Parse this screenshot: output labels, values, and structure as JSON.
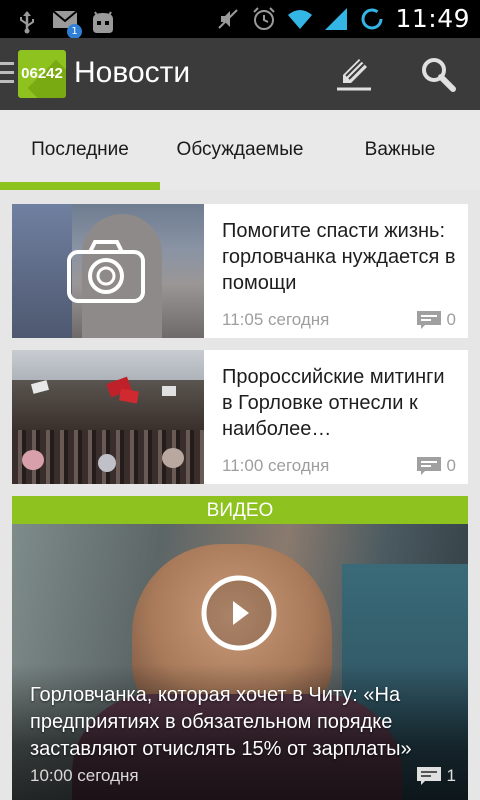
{
  "status_bar": {
    "time": "11:49",
    "left_icons": [
      "usb-icon",
      "mail-icon",
      "cyanogen-icon"
    ],
    "right_icons": [
      "mute-icon",
      "alarm-icon",
      "wifi-icon",
      "signal-icon",
      "battery-icon"
    ],
    "notification_count": "1"
  },
  "app_bar": {
    "logo_text": "06242",
    "title": "Новости",
    "accent_color": "#8dc21f",
    "actions": [
      "pencil-icon",
      "search-icon"
    ]
  },
  "tabs": [
    {
      "label": "Последние",
      "selected": true
    },
    {
      "label": "Обсуждаемые",
      "selected": false
    },
    {
      "label": "Важные",
      "selected": false
    }
  ],
  "articles": [
    {
      "title": "Помогите спасти жизнь: горловчанка нуждается в помощи",
      "time": "11:05 сегодня",
      "comments": "0",
      "thumb": "camera-placeholder"
    },
    {
      "title": "Пророссийские митинги в Горловке отнесли к наиболее…",
      "time": "11:00 сегодня",
      "comments": "0",
      "thumb": "rally-photo"
    }
  ],
  "video": {
    "header": "ВИДЕО",
    "title": "Горловчанка, которая хочет в Читу: «На предприятиях в обязательном порядке заставляют отчислять 15% от зарплаты»",
    "time": "10:00 сегодня",
    "comments": "1"
  }
}
